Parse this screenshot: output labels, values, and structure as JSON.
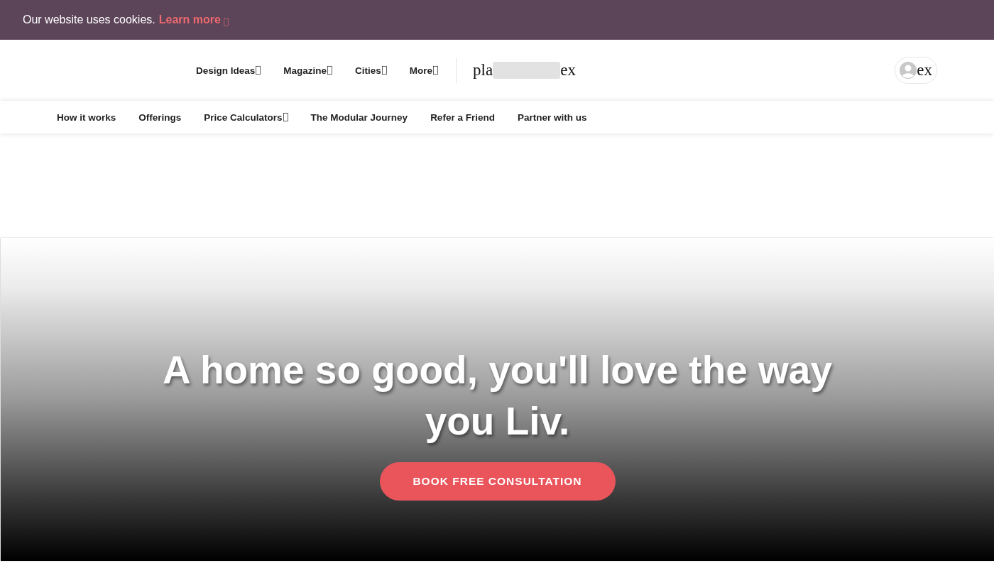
{
  "cookie_banner": {
    "text": "Our website uses cookies.",
    "link": "Learn more"
  },
  "main_nav": [
    {
      "label": "Design Ideas",
      "dropdown": true
    },
    {
      "label": "Magazine",
      "dropdown": true
    },
    {
      "label": "Cities",
      "dropdown": true
    },
    {
      "label": "More",
      "dropdown": true
    }
  ],
  "search": {
    "text_before": "pla",
    "text_after": "ex"
  },
  "account_button": {
    "label": "ex"
  },
  "sub_nav": [
    {
      "label": "How it works",
      "dropdown": false
    },
    {
      "label": "Offerings",
      "dropdown": false
    },
    {
      "label": "Price Calculators",
      "dropdown": true
    },
    {
      "label": "The Modular Journey",
      "dropdown": false
    },
    {
      "label": "Refer a Friend",
      "dropdown": false
    },
    {
      "label": "Partner with us",
      "dropdown": false
    }
  ],
  "hero": {
    "heading": "A home so good, you'll love the way you Liv.",
    "button": "BOOK FREE CONSULTATION"
  }
}
